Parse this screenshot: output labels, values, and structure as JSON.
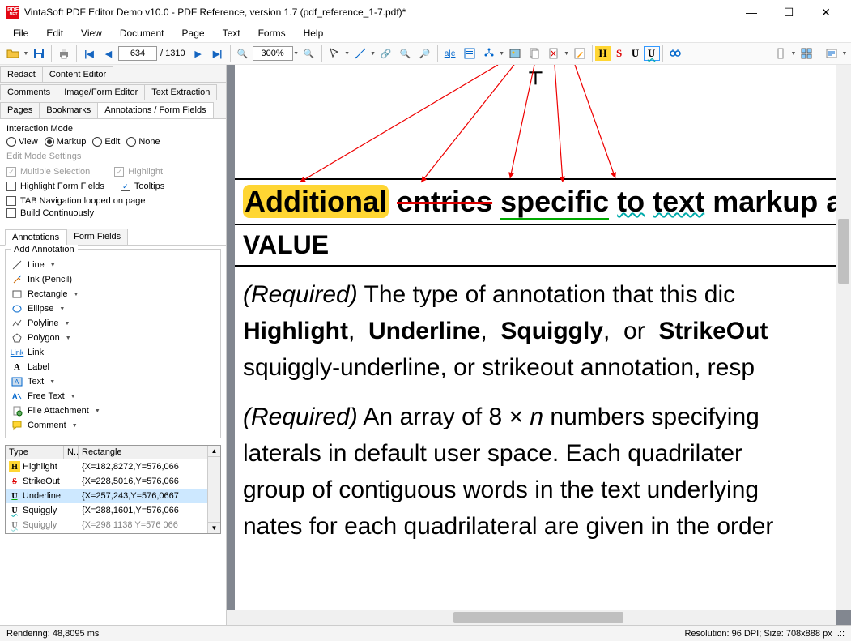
{
  "title": "VintaSoft PDF Editor Demo v10.0 - PDF Reference, version 1.7 (pdf_reference_1-7.pdf)*",
  "menu": [
    "File",
    "Edit",
    "View",
    "Document",
    "Page",
    "Text",
    "Forms",
    "Help"
  ],
  "nav": {
    "page": "634",
    "total": "1310",
    "zoom": "300%"
  },
  "side": {
    "tabs_row1": [
      "Redact",
      "Content Editor"
    ],
    "tabs_row2": [
      "Comments",
      "Image/Form Editor",
      "Text Extraction"
    ],
    "tabs_row3": [
      "Pages",
      "Bookmarks",
      "Annotations / Form Fields"
    ],
    "active_row3": "Annotations / Form Fields",
    "interaction_label": "Interaction Mode",
    "radios": [
      "View",
      "Markup",
      "Edit",
      "None"
    ],
    "radio_sel": "Markup",
    "editmode_label": "Edit Mode Settings",
    "multi_sel": "Multiple Selection",
    "highlight_chk": "Highlight",
    "hl_form": "Highlight Form  Fields",
    "tooltips": "Tooltips",
    "tabnav": "TAB Navigation looped on page",
    "buildcont": "Build Continuously",
    "subtabs": [
      "Annotations",
      "Form Fields"
    ],
    "subtab_active": "Annotations",
    "add_annot": "Add Annotation",
    "annots": [
      "Line",
      "Ink (Pencil)",
      "Rectangle",
      "Ellipse",
      "Polyline",
      "Polygon",
      "Link",
      "Label",
      "Text",
      "Free Text",
      "File Attachment",
      "Comment"
    ],
    "grid_cols": [
      "Type",
      "N..",
      "Rectangle"
    ],
    "grid_rows": [
      {
        "type": "Highlight",
        "rect": "{X=182,8272,Y=576,066"
      },
      {
        "type": "StrikeOut",
        "rect": "{X=228,5016,Y=576,066"
      },
      {
        "type": "Underline",
        "rect": "{X=257,243,Y=576,0667"
      },
      {
        "type": "Squiggly",
        "rect": "{X=288,1601,Y=576,066"
      },
      {
        "type": "Squiggly",
        "rect": "{X=298 1138 Y=576 066"
      }
    ]
  },
  "doc": {
    "title_words": {
      "w1": "Additional",
      "w2": "entries",
      "w3": "specific",
      "w4": "to",
      "w5": "text",
      "rest": "markup annot"
    },
    "value": "VALUE",
    "p1_req": "(Required)",
    "p1_1": " The type of annotation that this dic",
    "p1_2a": "Highlight",
    "p1_2b": "Underline",
    "p1_2c": "Squiggly",
    "p1_2d": "StrikeOut",
    "p1_3": "squiggly-underline, or strikeout annotation, resp",
    "p2_req": "(Required)",
    "p2_1": " An array of 8 × ",
    "p2_n": "n",
    "p2_1b": " numbers specifying ",
    "p2_2": "laterals in default user space. Each quadrilater",
    "p2_3": "group of contiguous words in the text underlying",
    "p2_4": "nates for each quadrilateral are given in the order"
  },
  "status": {
    "left": "Rendering: 48,8095 ms",
    "right": "Resolution: 96 DPI; Size: 708x888 px"
  }
}
